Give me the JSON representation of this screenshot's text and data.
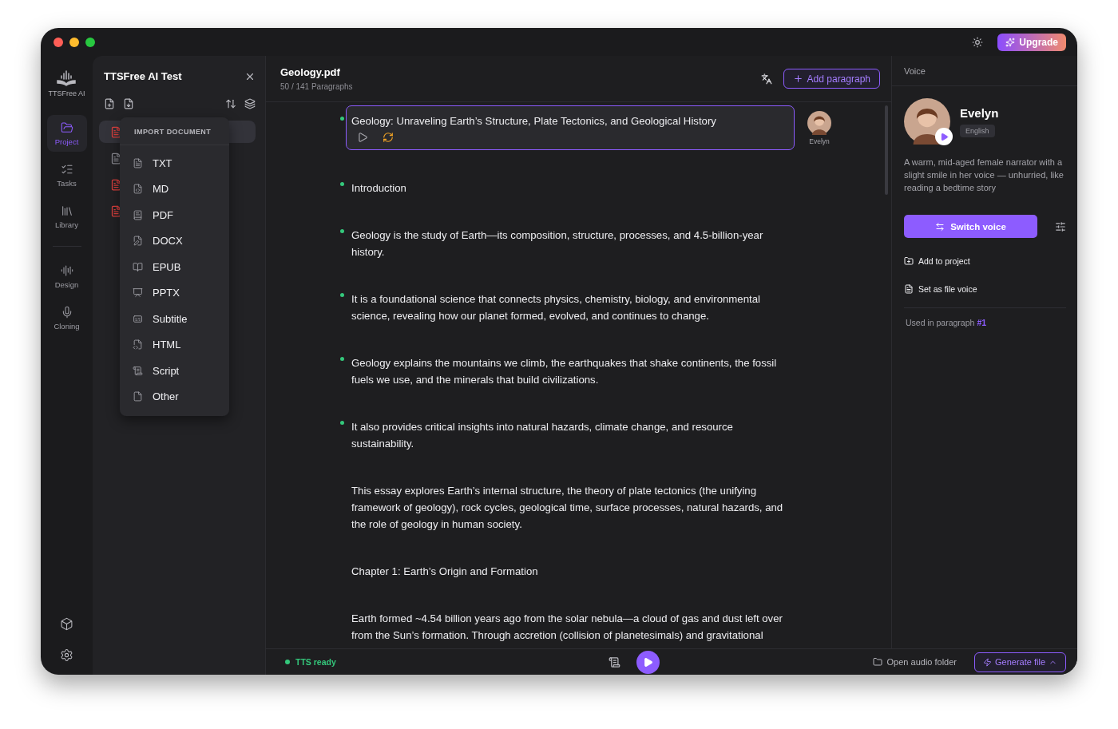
{
  "topbar": {
    "upgrade_button": "Upgrade"
  },
  "rail": {
    "logo": "TTSFree AI",
    "primary_items": [
      {
        "kind": "project",
        "label": "Project",
        "selected": true
      },
      {
        "kind": "tasks",
        "label": "Tasks",
        "selected": false
      },
      {
        "kind": "library",
        "label": "Library",
        "selected": false
      }
    ],
    "secondary_items": [
      {
        "kind": "design",
        "label": "Design",
        "selected": false
      },
      {
        "kind": "cloning",
        "label": "Cloning",
        "selected": false
      }
    ]
  },
  "project_panel": {
    "title": "TTSFree AI Test",
    "files": [
      {
        "kind": "pdf",
        "selected": true
      },
      {
        "kind": "txt",
        "selected": false
      },
      {
        "kind": "pdf",
        "selected": false
      },
      {
        "kind": "pdf",
        "selected": false
      }
    ]
  },
  "import_menu": {
    "heading": "IMPORT DOCUMENT",
    "items": [
      {
        "kind": "txt",
        "label": "TXT"
      },
      {
        "kind": "md",
        "label": "MD"
      },
      {
        "kind": "pdf",
        "label": "PDF"
      },
      {
        "kind": "docx",
        "label": "DOCX"
      },
      {
        "kind": "epub",
        "label": "EPUB"
      },
      {
        "kind": "pptx",
        "label": "PPTX"
      },
      {
        "kind": "subtitle",
        "label": "Subtitle"
      },
      {
        "kind": "html",
        "label": "HTML"
      },
      {
        "kind": "script",
        "label": "Script"
      },
      {
        "kind": "other",
        "label": "Other"
      }
    ]
  },
  "document": {
    "title": "Geology.pdf",
    "progress": "50 / 141 Paragraphs",
    "add_button": "Add paragraph"
  },
  "paragraphs": [
    {
      "text": "Geology: Unraveling Earth’s Structure, Plate Tectonics, and Geological History",
      "generated": true,
      "selected": true,
      "voice": "Evelyn"
    },
    {
      "text": "Introduction",
      "generated": true,
      "selected": false
    },
    {
      "text": "Geology is the study of Earth—its composition, structure, processes, and 4.5-billion-year history.",
      "generated": true,
      "selected": false
    },
    {
      "text": "It is a foundational science that connects physics, chemistry, biology, and environmental science, revealing how our planet formed, evolved, and continues to change.",
      "generated": true,
      "selected": false
    },
    {
      "text": "Geology explains the mountains we climb, the earthquakes that shake continents, the fossil fuels we use, and the minerals that build civilizations.",
      "generated": true,
      "selected": false
    },
    {
      "text": "It also provides critical insights into natural hazards, climate change, and resource sustainability.",
      "generated": true,
      "selected": false
    },
    {
      "text": "This essay explores Earth’s internal structure, the theory of plate tectonics (the unifying framework of geology), rock cycles, geological time, surface processes, natural hazards, and the role of geology in human society.",
      "generated": false,
      "selected": false
    },
    {
      "text": "Chapter 1: Earth’s Origin and Formation",
      "generated": false,
      "selected": false
    },
    {
      "text": "Earth formed ~4.54 billion years ago from the solar nebula—a cloud of gas and dust left over from the Sun’s formation. Through accretion (collision of planetesimals) and gravitational",
      "generated": false,
      "selected": false
    }
  ],
  "voice_panel": {
    "heading": "Voice",
    "name": "Evelyn",
    "language": "English",
    "description": "A warm, mid-aged female narrator with a slight smile in her voice — unhurried, like reading a bedtime story",
    "switch_button": "Switch voice",
    "actions": [
      {
        "kind": "add",
        "label": "Add to project"
      },
      {
        "kind": "file",
        "label": "Set as file voice"
      }
    ],
    "usage_label": "Used in paragraph",
    "usage_link": "#1"
  },
  "status_bar": {
    "status": "TTS ready",
    "open_folder": "Open audio folder",
    "generate_button": "Generate file"
  }
}
